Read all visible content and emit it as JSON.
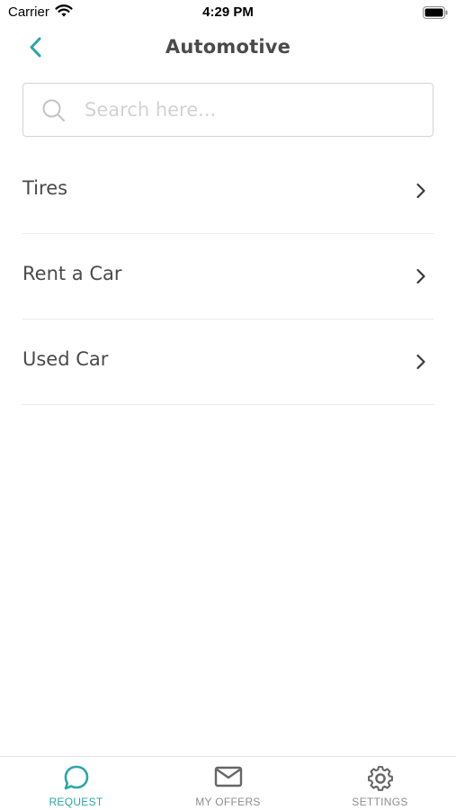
{
  "status_bar": {
    "carrier": "Carrier",
    "time": "4:29 PM"
  },
  "nav": {
    "title": "Automotive",
    "back_icon": "chevron-left-icon"
  },
  "search": {
    "placeholder": "Search here...",
    "value": "",
    "icon": "search-icon"
  },
  "categories": [
    {
      "label": "Tires"
    },
    {
      "label": "Rent a Car"
    },
    {
      "label": "Used Car"
    }
  ],
  "tabs": [
    {
      "label": "REQUEST",
      "icon": "chat-bubble-icon",
      "active": true
    },
    {
      "label": "MY OFFERS",
      "icon": "envelope-icon",
      "active": false
    },
    {
      "label": "SETTINGS",
      "icon": "gear-icon",
      "active": false
    }
  ],
  "colors": {
    "accent": "#2aa6a9",
    "text": "#4a4a4a",
    "inactive": "#8e8e8e",
    "divider": "#ececec"
  }
}
